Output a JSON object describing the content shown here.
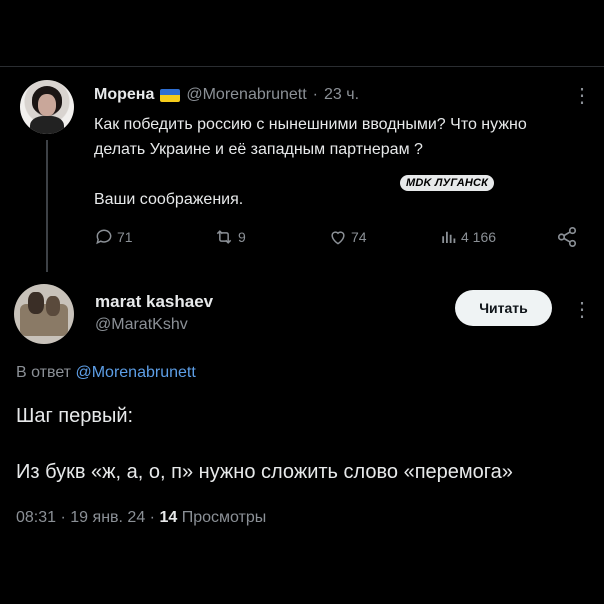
{
  "colors": {
    "background": "#000000",
    "text": "#e7e9ea",
    "secondary": "#8b9096",
    "link": "#5d9ee6",
    "follow_button_bg": "#eff3f4",
    "flag_blue": "#2f6fd1",
    "flag_yellow": "#f5cc1c"
  },
  "parent_tweet": {
    "author_name": "Морена",
    "flag_icon": "ukraine-flag-icon",
    "handle": "@Morenabrunett",
    "separator": "·",
    "time": "23 ч.",
    "text": "Как победить россию с нынешними вводными? Что нужно делать Украине и её западным партнерам ?\n\nВаши соображения.",
    "watermark": "MDK ЛУГАНСК",
    "actions": {
      "replies": "71",
      "reposts": "9",
      "likes": "74",
      "views": "4 166"
    },
    "icons": {
      "reply": "reply-icon",
      "repost": "repost-icon",
      "like": "heart-icon",
      "views": "views-icon",
      "share": "share-icon",
      "more": "more-icon"
    }
  },
  "main_tweet": {
    "author_name": "marat kashaev",
    "handle": "@MaratKshv",
    "follow_label": "Читать",
    "reply_prefix": "В ответ",
    "reply_mention": "@Morenabrunett",
    "paragraph_1": "Шаг первый:",
    "paragraph_2": "Из букв «ж, а, о, п» нужно сложить слово «перемога»",
    "time": "08:31",
    "date": "19 янв. 24",
    "separator": "·",
    "views_count": "14",
    "views_label": "Просмотры"
  }
}
